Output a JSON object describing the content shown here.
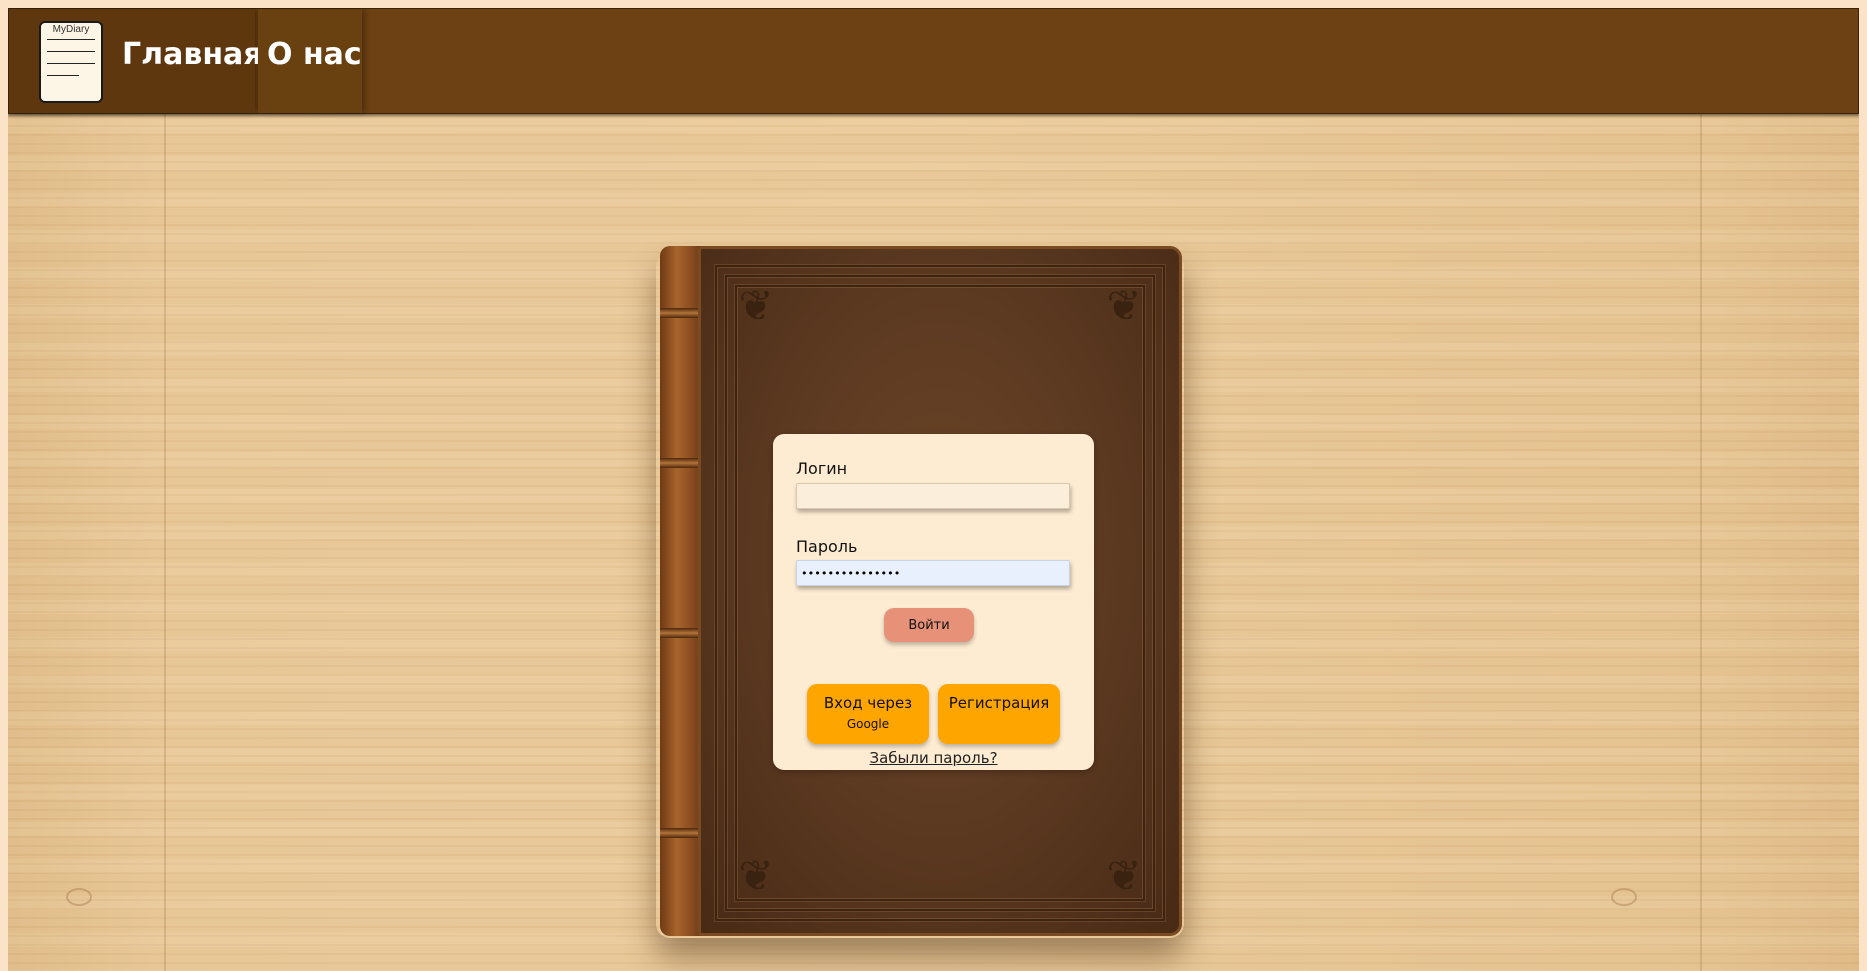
{
  "header": {
    "logo_text": "MyDiary",
    "nav": [
      {
        "label": "Главная"
      },
      {
        "label": "О нас"
      }
    ]
  },
  "login_form": {
    "login_label": "Логин",
    "login_value": "",
    "password_label": "Пароль",
    "password_value": "•••••••••••••••",
    "submit_label": "Войти",
    "google_button": {
      "line1": "Вход через",
      "line2": "Google"
    },
    "register_label": "Регистрация",
    "forgot_label": "Забыли пароль?"
  },
  "colors": {
    "header_bg": "#6d4113",
    "card_bg": "#feecd2",
    "login_button": "#e79178",
    "accent_orange": "#ffa500"
  }
}
